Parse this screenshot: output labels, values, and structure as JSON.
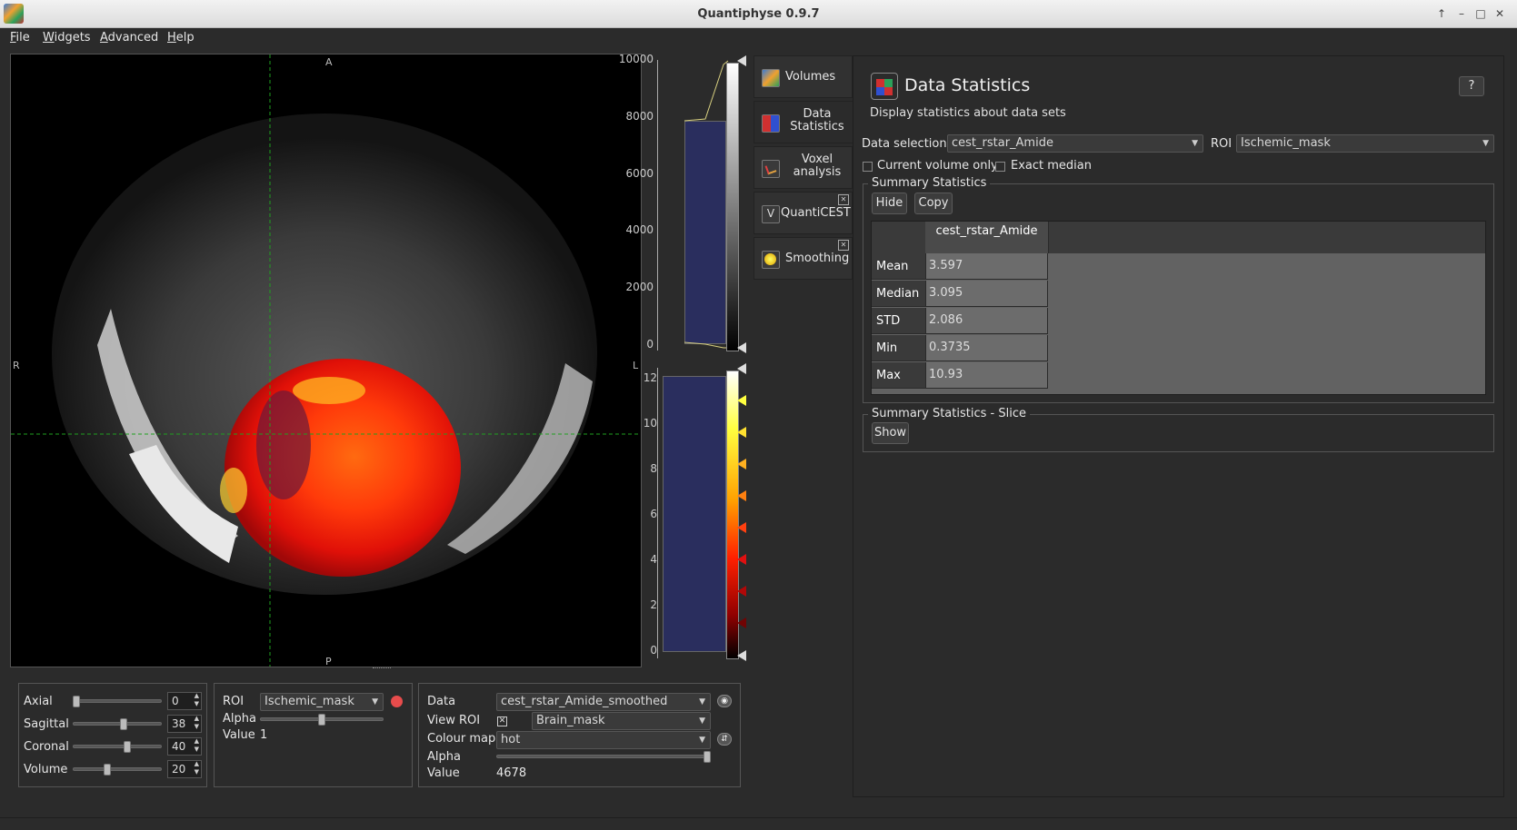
{
  "window": {
    "title": "Quantiphyse 0.9.7"
  },
  "menu": [
    "File",
    "Widgets",
    "Advanced",
    "Help"
  ],
  "viewer": {
    "orient_top": "A",
    "orient_bottom": "P",
    "orient_left": "R",
    "orient_right": "L"
  },
  "colorbar_top": {
    "ticks": [
      "10000",
      "8000",
      "6000",
      "4000",
      "2000",
      "0"
    ]
  },
  "colorbar_bottom": {
    "ticks": [
      "12",
      "10",
      "8",
      "6",
      "4",
      "2",
      "0"
    ]
  },
  "sidetabs": [
    {
      "label_line1": "Volumes",
      "label_line2": "",
      "icon": "volumes-icon"
    },
    {
      "label_line1": "Data",
      "label_line2": "Statistics",
      "icon": "data-statistics-icon"
    },
    {
      "label_line1": "Voxel",
      "label_line2": "analysis",
      "icon": "voxel-analysis-icon"
    },
    {
      "label_line1": "QuantiCEST",
      "label_line2": "",
      "icon": "quanticest-icon"
    },
    {
      "label_line1": "Smoothing",
      "label_line2": "",
      "icon": "smoothing-icon"
    }
  ],
  "panel": {
    "title": "Data Statistics",
    "subtitle": "Display statistics about data sets",
    "help_label": "?",
    "data_selection_label": "Data selection",
    "data_selection_value": "cest_rstar_Amide",
    "roi_label": "ROI",
    "roi_value": "Ischemic_mask",
    "current_volume_only": "Current volume only",
    "exact_median": "Exact median",
    "summary_title": "Summary Statistics",
    "hide_label": "Hide",
    "copy_label": "Copy",
    "column_header": "cest_rstar_Amide",
    "stats": [
      {
        "name": "Mean",
        "value": "3.597"
      },
      {
        "name": "Median",
        "value": "3.095"
      },
      {
        "name": "STD",
        "value": "2.086"
      },
      {
        "name": "Min",
        "value": "0.3735"
      },
      {
        "name": "Max",
        "value": "10.93"
      }
    ],
    "slice_title": "Summary Statistics - Slice",
    "show_label": "Show"
  },
  "nav": {
    "axial_label": "Axial",
    "axial_value": "0",
    "axial_level": 0.0,
    "sagittal_label": "Sagittal",
    "sagittal_value": "38",
    "sagittal_level": 0.58,
    "coronal_label": "Coronal",
    "coronal_value": "40",
    "coronal_level": 0.62,
    "volume_label": "Volume",
    "volume_value": "20",
    "volume_level": 0.38
  },
  "roi_ctrl": {
    "roi_label": "ROI",
    "roi_value": "Ischemic_mask",
    "alpha_label": "Alpha",
    "alpha_level": 0.5,
    "value_label": "Value",
    "value": "1",
    "roi_color": "#e74c4c"
  },
  "data_ctrl": {
    "data_label": "Data",
    "data_value": "cest_rstar_Amide_smoothed",
    "view_roi_label": "View ROI",
    "view_roi_value": "Brain_mask",
    "colour_map_label": "Colour map",
    "colour_map_value": "hot",
    "alpha_label": "Alpha",
    "alpha_level": 1.0,
    "value_label": "Value",
    "value": "4678"
  }
}
